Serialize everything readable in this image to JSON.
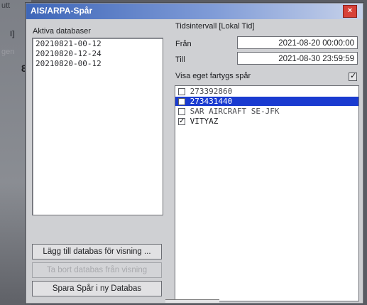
{
  "background": {
    "fragments": [
      "utt",
      "I]",
      "gen",
      "8"
    ]
  },
  "window": {
    "title": "AIS/ARPA-Spår",
    "close_label": "×"
  },
  "databases": {
    "label": "Aktiva databaser",
    "items": [
      "20210821-00-12",
      "20210820-12-24",
      "20210820-00-12"
    ]
  },
  "time": {
    "label": "Tidsintervall [Lokal Tid]",
    "from_label": "Från",
    "from_value": "2021-08-20 00:00:00",
    "to_label": "Till",
    "to_value": "2021-08-30 23:59:59"
  },
  "own_track": {
    "label": "Visa eget fartygs spår",
    "checked": true
  },
  "vessels": [
    {
      "name": "273392860",
      "checked": false,
      "selected": false
    },
    {
      "name": "273431440",
      "checked": false,
      "selected": true
    },
    {
      "name": "SAR AIRCRAFT SE-JFK",
      "checked": false,
      "selected": false
    },
    {
      "name": "VITYAZ",
      "checked": true,
      "selected": false
    }
  ],
  "buttons": {
    "add_db": "Lägg till databas för visning ...",
    "remove_db": "Ta bort databas från visning",
    "save_tracks": "Spara Spår i ny Databas"
  },
  "colors": {
    "title_bar": "#3e66b8",
    "selection": "#1a3bd0",
    "close": "#d7413a"
  }
}
